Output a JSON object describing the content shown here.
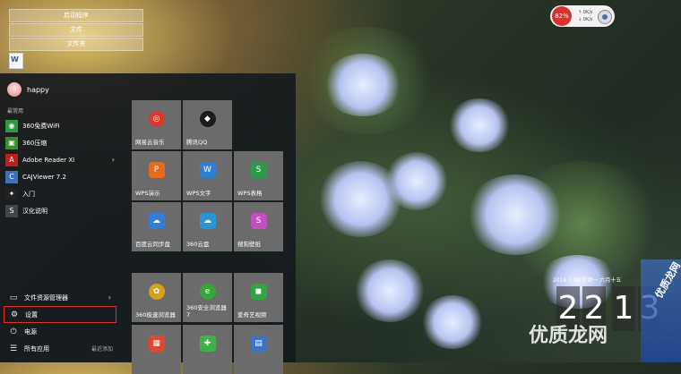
{
  "desktop": {
    "folder_items": [
      "启动程序",
      "文件",
      "文件夹"
    ],
    "doc_icon_glyph": "W"
  },
  "start_menu": {
    "user": {
      "name": "happy"
    },
    "section_label": "最常用",
    "apps": [
      {
        "label": "360免费WiFi",
        "icon": "wifi-icon",
        "color": "#2c9a3f",
        "glyph": "◉"
      },
      {
        "label": "360压缩",
        "icon": "compress-icon",
        "color": "#3a8f2f",
        "glyph": "▣"
      },
      {
        "label": "Adobe Reader XI",
        "icon": "pdf-icon",
        "color": "#b7221a",
        "glyph": "A",
        "has_submenu": true
      },
      {
        "label": "CAJViewer 7.2",
        "icon": "cajviewer-icon",
        "color": "#3f6fb5",
        "glyph": "C"
      },
      {
        "label": "入门",
        "icon": "lightbulb-icon",
        "color": "#222222",
        "glyph": "✦"
      },
      {
        "label": "汉化说明",
        "icon": "s-doc-icon",
        "color": "#444444",
        "glyph": "S"
      }
    ],
    "bottom": [
      {
        "label": "文件资源管理器",
        "icon": "folder-icon",
        "glyph": "▭",
        "has_submenu": true
      },
      {
        "label": "设置",
        "icon": "gear-icon",
        "glyph": "⚙",
        "highlighted": true
      },
      {
        "label": "电源",
        "icon": "power-icon",
        "glyph": "⏻"
      },
      {
        "label": "所有应用",
        "icon": "apps-icon",
        "glyph": "☰",
        "recent_label": "最近添加"
      }
    ],
    "tiles": [
      {
        "label": "网易云音乐",
        "icon": "netease-music-icon",
        "color": "#d53a2e",
        "glyph": "◎"
      },
      {
        "label": "腾讯QQ",
        "icon": "qq-icon",
        "color": "#1c1c1c",
        "glyph": "◆"
      },
      {
        "label": "WPS演示",
        "icon": "wps-presentation-icon",
        "color": "#e86a1c",
        "glyph": "P"
      },
      {
        "label": "WPS文字",
        "icon": "wps-writer-icon",
        "color": "#2d7fd6",
        "glyph": "W"
      },
      {
        "label": "WPS表格",
        "icon": "wps-sheet-icon",
        "color": "#2b9a4b",
        "glyph": "S"
      },
      {
        "label": "百度云同步盘",
        "icon": "baidu-sync-icon",
        "color": "#2f7ed8",
        "glyph": "☁"
      },
      {
        "label": "360云盘",
        "icon": "cloud-drive-icon",
        "color": "#2a95d6",
        "glyph": "☁"
      },
      {
        "label": "搜狗壁纸",
        "icon": "sogou-wallpaper-icon",
        "color": "#c34ec4",
        "glyph": "S"
      },
      {
        "label": "360极速浏览器",
        "icon": "360-browser-icon",
        "color": "#d4a11d",
        "glyph": "✿"
      },
      {
        "label": "360安全浏览器\n7",
        "icon": "360-safe-browser-icon",
        "color": "#3aa43a",
        "glyph": "e"
      },
      {
        "label": "爱奇艺视频",
        "icon": "iqiyi-icon",
        "color": "#2fa543",
        "glyph": "◼"
      },
      {
        "label": "",
        "icon": "windows-colorful-icon",
        "color": "#e0472c",
        "glyph": "▦"
      },
      {
        "label": "",
        "icon": "game-plus-icon",
        "color": "#3bb24a",
        "glyph": "✚"
      },
      {
        "label": "",
        "icon": "calculator-icon",
        "color": "#3c74c5",
        "glyph": "▤"
      }
    ]
  },
  "system_widget": {
    "cpu_percent": "82%",
    "upload": "0K/s",
    "download": "0K/s"
  },
  "clock": {
    "date": "2016.7.18  星期一  六月十五",
    "digits": [
      "2",
      "2",
      "1",
      "3"
    ]
  },
  "watermark": {
    "text": "优质龙网",
    "corner": "优质龙网"
  }
}
